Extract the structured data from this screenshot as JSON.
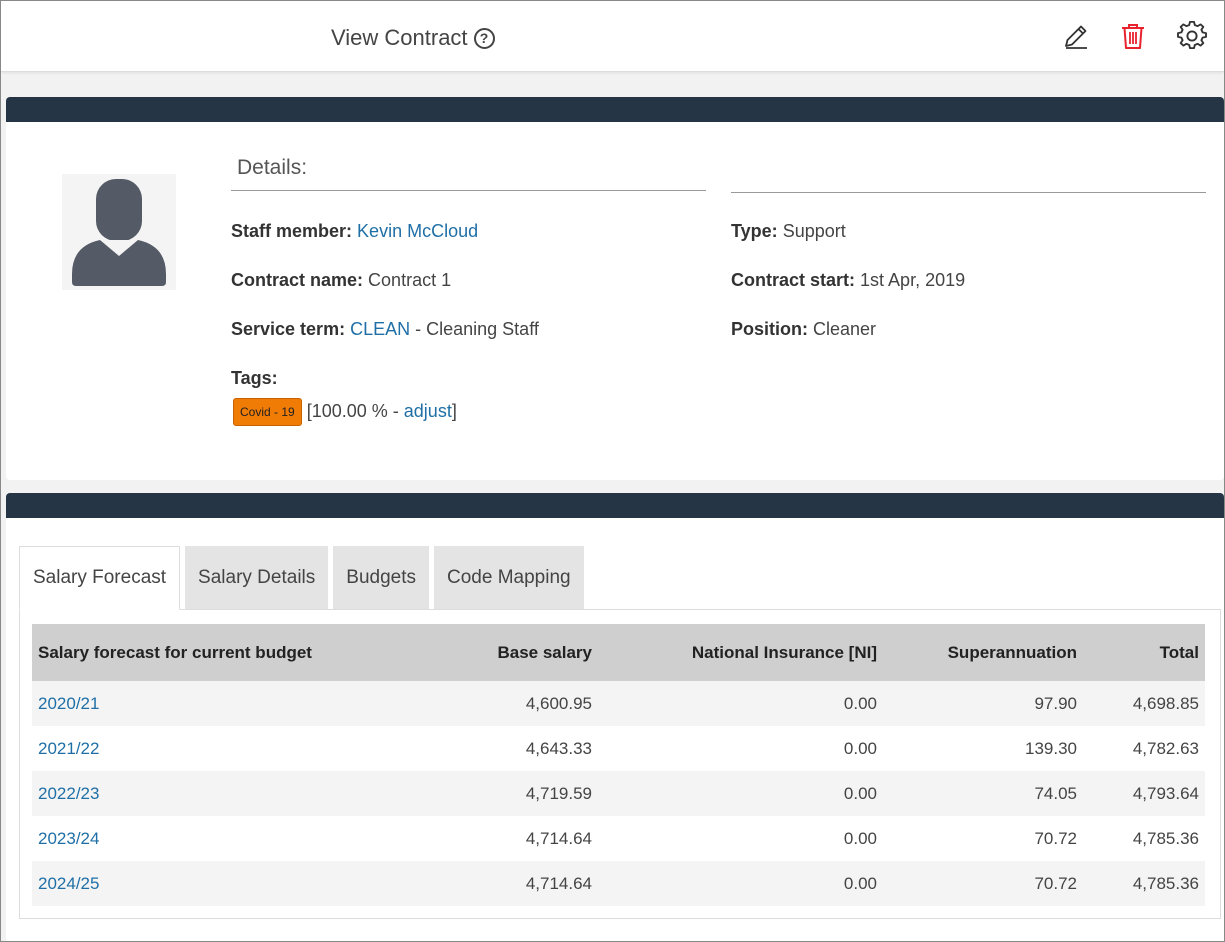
{
  "header": {
    "title": "View Contract",
    "help_symbol": "?",
    "icons": [
      "pencil-icon",
      "trash-icon",
      "gear-icon"
    ],
    "delete_color": "#e8232d"
  },
  "details": {
    "heading": "Details:",
    "staff_member": {
      "label": "Staff member:",
      "value": "Kevin McCloud"
    },
    "contract_name": {
      "label": "Contract name:",
      "value": "Contract 1"
    },
    "service_term": {
      "label": "Service term:",
      "code": "CLEAN",
      "separator": " - ",
      "description": "Cleaning Staff"
    },
    "tags": {
      "label": "Tags:",
      "badge": "Covid - 19",
      "badge_color": "#f07b05",
      "allocation_prefix": "[100.00 % - ",
      "adjust_link": "adjust",
      "allocation_suffix": "]"
    },
    "type": {
      "label": "Type:",
      "value": "Support"
    },
    "contract_start": {
      "label": "Contract start:",
      "value": "1st Apr, 2019"
    },
    "position": {
      "label": "Position:",
      "value": "Cleaner"
    }
  },
  "tabs": [
    {
      "label": "Salary Forecast",
      "active": true
    },
    {
      "label": "Salary Details",
      "active": false
    },
    {
      "label": "Budgets",
      "active": false
    },
    {
      "label": "Code Mapping",
      "active": false
    }
  ],
  "forecast_table": {
    "columns": [
      "Salary forecast for current budget",
      "Base salary",
      "National Insurance [NI]",
      "Superannuation",
      "Total"
    ],
    "rows": [
      {
        "year": "2020/21",
        "base": "4,600.95",
        "ni": "0.00",
        "super": "97.90",
        "total": "4,698.85"
      },
      {
        "year": "2021/22",
        "base": "4,643.33",
        "ni": "0.00",
        "super": "139.30",
        "total": "4,782.63"
      },
      {
        "year": "2022/23",
        "base": "4,719.59",
        "ni": "0.00",
        "super": "74.05",
        "total": "4,793.64"
      },
      {
        "year": "2023/24",
        "base": "4,714.64",
        "ni": "0.00",
        "super": "70.72",
        "total": "4,785.36"
      },
      {
        "year": "2024/25",
        "base": "4,714.64",
        "ni": "0.00",
        "super": "70.72",
        "total": "4,785.36"
      }
    ]
  },
  "theme": {
    "panel_header": "#253545",
    "link": "#1f6fa6"
  }
}
